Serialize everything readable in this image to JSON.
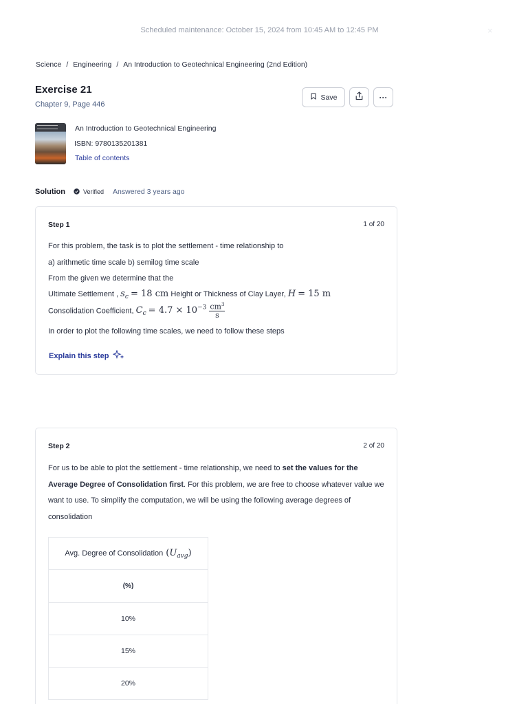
{
  "banner": {
    "text": "Scheduled maintenance: October 15, 2024 from 10:45 AM to 12:45 PM",
    "close": "×"
  },
  "breadcrumb": {
    "items": [
      "Science",
      "Engineering",
      "An Introduction to Geotechnical Engineering (2nd Edition)"
    ],
    "separator": "/"
  },
  "exercise": {
    "title": "Exercise 21",
    "subtitle": "Chapter 9, Page 446"
  },
  "actions": {
    "save_label": "Save",
    "more_label": "···"
  },
  "book": {
    "title": "An Introduction to Geotechnical Engineering",
    "isbn": "ISBN: 9780135201381",
    "toc": "Table of contents"
  },
  "solution": {
    "label": "Solution",
    "verified": "Verified",
    "answered": "Answered 3 years ago"
  },
  "step1": {
    "label": "Step 1",
    "count": "1 of 20",
    "line1": "For this problem, the task is to plot the settlement - time relationship to",
    "line2": "a) arithmetic time scale b) semilog time scale",
    "line3": "From the given we determine that the",
    "line4_a": "Ultimate Settlement ,",
    "line4_b": "Height or Thickness of Clay Layer,",
    "line5_a": "Consolidation Coefficient,",
    "line6": "In order to plot the following time scales, we need to follow these steps",
    "explain": "Explain this step"
  },
  "step2": {
    "label": "Step 2",
    "count": "2 of 20",
    "p_a": "For us to be able to plot the settlement - time relationship, we need to ",
    "p_bold": "set the values for the Average Degree of Consolidation first",
    "p_b": ". For this problem, we are free to choose whatever value we want to use. To simplify the computation, we will be using the following average degrees of consolidation",
    "table": {
      "header": "Avg. Degree of Consolidation",
      "unit": "(%)",
      "rows": [
        "10%",
        "15%",
        "20%"
      ]
    }
  },
  "colors": {
    "link": "#2a3b9c",
    "text": "#282e3e",
    "muted": "#4a5c80",
    "border": "#e3e5ea"
  }
}
